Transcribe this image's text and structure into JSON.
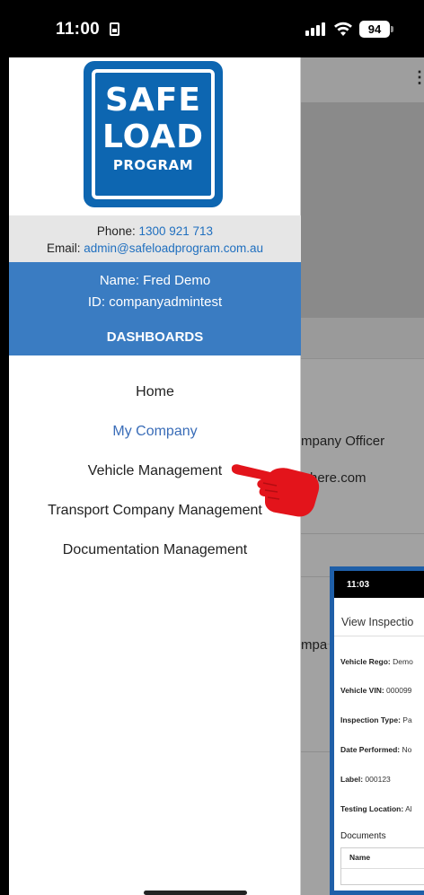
{
  "status_bar": {
    "time": "11:00",
    "battery": "94"
  },
  "drawer": {
    "logo": {
      "line1": "SAFE",
      "line2": "LOAD",
      "line3": "PROGRAM"
    },
    "contact": {
      "phone_label": "Phone:",
      "phone": "1300 921 713",
      "email_label": "Email:",
      "email": "admin@safeloadprogram.com.au"
    },
    "user": {
      "name": "Name: Fred Demo",
      "id": "ID: companyadmintest",
      "section_title": "DASHBOARDS"
    },
    "nav_items": [
      {
        "label": "Home",
        "active": false
      },
      {
        "label": "My Company",
        "active": true
      },
      {
        "label": "Vehicle Management",
        "active": false
      },
      {
        "label": "Transport Company Management",
        "active": false
      },
      {
        "label": "Documentation Management",
        "active": false
      }
    ]
  },
  "background_app": {
    "menu_icon": "more-vertical-icon",
    "officer_text": "mpany Officer",
    "email_text": "here.com",
    "company_text": "mpa"
  },
  "inset_screenshot": {
    "time": "11:03",
    "title": "View Inspectio",
    "fields": [
      {
        "label": "Vehicle Rego:",
        "value": "Demo"
      },
      {
        "label": "Vehicle VIN:",
        "value": "000099"
      },
      {
        "label": "Inspection Type:",
        "value": "Pa"
      },
      {
        "label": "Date Performed:",
        "value": "No"
      },
      {
        "label": "Label:",
        "value": "000123"
      },
      {
        "label": "Testing Location:",
        "value": "Al"
      }
    ],
    "documents_title": "Documents",
    "table_header": "Name"
  },
  "colors": {
    "logo_blue": "#0d66b1",
    "user_panel": "#3a7cc2",
    "link": "#1f6fbf",
    "pointer_red": "#e3141b",
    "inset_border": "#1f5fa8"
  }
}
